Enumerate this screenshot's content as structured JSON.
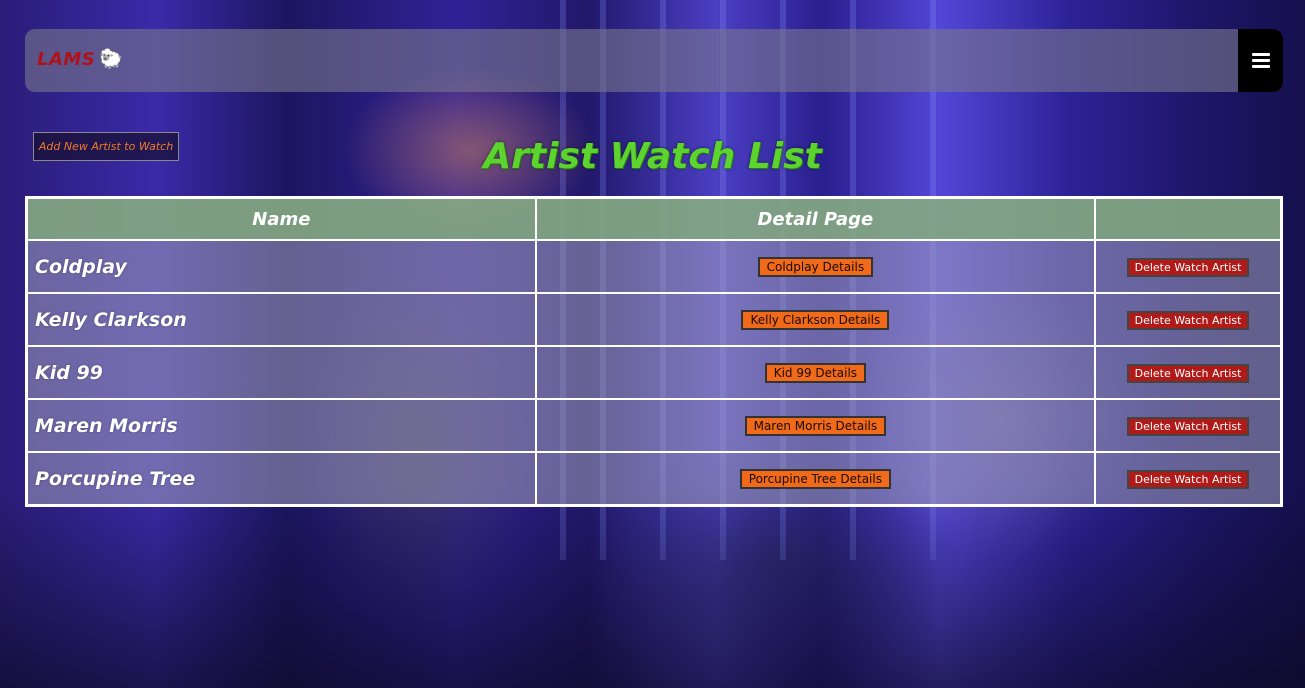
{
  "app": {
    "brand": "LAMS",
    "brand_icon": "🐑"
  },
  "actions": {
    "add_artist_label": "Add New Artist to Watch"
  },
  "page": {
    "title": "Artist Watch List"
  },
  "table": {
    "headers": {
      "name": "Name",
      "detail": "Detail Page",
      "action": ""
    },
    "rows": [
      {
        "name": "Coldplay",
        "detail_label": "Coldplay Details",
        "delete_label": "Delete Watch Artist"
      },
      {
        "name": "Kelly Clarkson",
        "detail_label": "Kelly Clarkson Details",
        "delete_label": "Delete Watch Artist"
      },
      {
        "name": "Kid 99",
        "detail_label": "Kid 99 Details",
        "delete_label": "Delete Watch Artist"
      },
      {
        "name": "Maren Morris",
        "detail_label": "Maren Morris Details",
        "delete_label": "Delete Watch Artist"
      },
      {
        "name": "Porcupine Tree",
        "detail_label": "Porcupine Tree Details",
        "delete_label": "Delete Watch Artist"
      }
    ]
  },
  "icons": {
    "menu": "hamburger-menu-icon",
    "brand": "sheep-icon"
  },
  "colors": {
    "brand": "#b0121a",
    "title": "#5cd32e",
    "detail_button": "#f06a1a",
    "delete_button": "#b01a18",
    "header_row": "#84a882"
  }
}
